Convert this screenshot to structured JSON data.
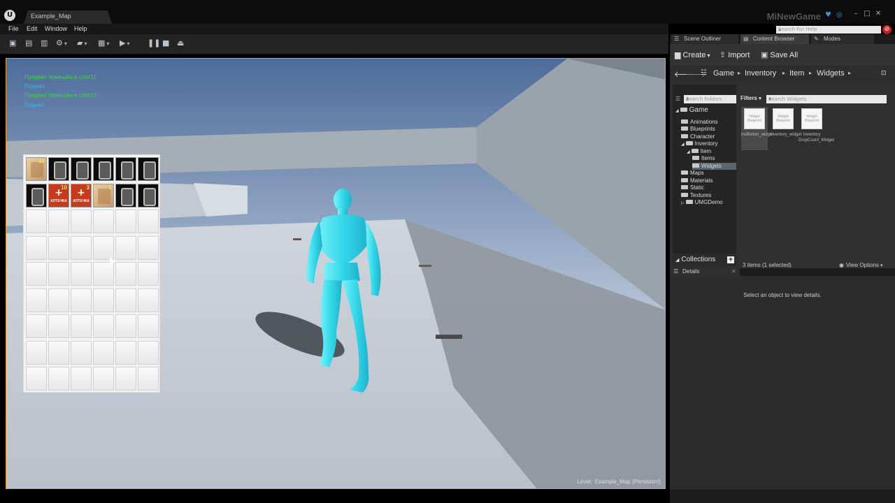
{
  "window": {
    "logo": "U",
    "doc_tab": "Example_Map",
    "project_name": "MiNewGame"
  },
  "menu": [
    "File",
    "Edit",
    "Window",
    "Help"
  ],
  "help_search": {
    "placeholder": "Search For Help"
  },
  "toolbar": {
    "buttons": [
      "save-icon",
      "source-control-icon",
      "content-icon",
      "settings-icon",
      "blueprints-icon",
      "matinee-icon",
      "play-icon",
      "pause-icon",
      "stop-icon",
      "eject-icon"
    ]
  },
  "viewport": {
    "debug_messages": [
      {
        "text": "Предмет помещён в слот11",
        "color": "#3fd43f"
      },
      {
        "text": "Поднял",
        "color": "#3ab6e8"
      },
      {
        "text": "Предмет помещён в слот10",
        "color": "#3fd43f"
      },
      {
        "text": "Поднял",
        "color": "#3ab6e8"
      }
    ],
    "level_key": "Level:",
    "level_value": "Example_Map (Persistent)"
  },
  "inventory": {
    "columns": 6,
    "rows": 9,
    "items": [
      {
        "slot": 0,
        "kind": "scroll",
        "count": "10"
      },
      {
        "slot": 1,
        "kind": "phone"
      },
      {
        "slot": 2,
        "kind": "phone"
      },
      {
        "slot": 3,
        "kind": "phone"
      },
      {
        "slot": 4,
        "kind": "phone"
      },
      {
        "slot": 5,
        "kind": "phone"
      },
      {
        "slot": 6,
        "kind": "phone"
      },
      {
        "slot": 7,
        "kind": "medkit",
        "count": "10",
        "subtext": "АПТЕЧКА"
      },
      {
        "slot": 8,
        "kind": "medkit",
        "count": "3",
        "subtext": "АПТЕЧКА"
      },
      {
        "slot": 9,
        "kind": "scroll",
        "count": "5"
      },
      {
        "slot": 10,
        "kind": "phone"
      },
      {
        "slot": 11,
        "kind": "phone"
      }
    ]
  },
  "panels": {
    "tabs": [
      {
        "label": "Scene Outliner",
        "icon": "list-icon"
      },
      {
        "label": "Content Browser",
        "icon": "folder-icon"
      },
      {
        "label": "Modes",
        "icon": "brush-icon"
      }
    ]
  },
  "content_browser": {
    "create": "Create",
    "import": "Import",
    "save_all": "Save All",
    "path": [
      "Game",
      "Inventory",
      "Item",
      "Widgets"
    ],
    "search_folders_placeholder": "Search Folders",
    "filters": "Filters",
    "search_widgets_placeholder": "Search Widgets",
    "tree": [
      {
        "label": "Game",
        "level": 0,
        "expanded": true
      },
      {
        "label": "Animations",
        "level": 1
      },
      {
        "label": "Blueprints",
        "level": 1
      },
      {
        "label": "Character",
        "level": 1
      },
      {
        "label": "Inventory",
        "level": 1,
        "expanded": true
      },
      {
        "label": "Item",
        "level": 2,
        "expanded": true
      },
      {
        "label": "Items",
        "level": 3
      },
      {
        "label": "Widgets",
        "level": 3,
        "selected": true
      },
      {
        "label": "Maps",
        "level": 1
      },
      {
        "label": "Materials",
        "level": 1
      },
      {
        "label": "Static",
        "level": 1
      },
      {
        "label": "Textures",
        "level": 1
      },
      {
        "label": "UMGDemo",
        "level": 1,
        "collapsed": true
      }
    ],
    "collections": "Collections",
    "assets": [
      {
        "name": "InvButton_widget",
        "thumb": "Widget Blueprint",
        "selected": true
      },
      {
        "name": "Inventory_widget",
        "thumb": "Widget Blueprint"
      },
      {
        "name": "Inventory DropCount_Widget",
        "thumb": "Widget Blueprint"
      }
    ],
    "item_count": "3 items (1 selected)",
    "view_options": "View Options"
  },
  "details": {
    "tab": "Details",
    "empty": "Select an object to view details."
  },
  "colors": {
    "viewport_border": "#e5a020",
    "character": "#3fe0ee"
  }
}
